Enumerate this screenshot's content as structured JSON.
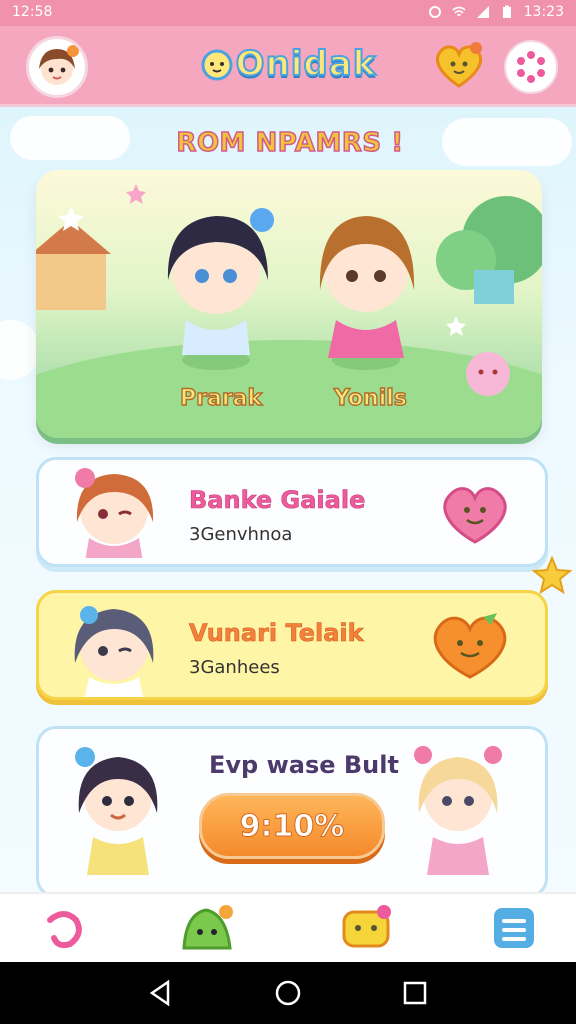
{
  "status_bar": {
    "left_text": "12:58",
    "time": "13:23"
  },
  "header": {
    "logo_text": "Onidak",
    "icons": {
      "profile": "avatar-girl-icon",
      "favorites": "heart-icon",
      "settings": "gear-icon"
    }
  },
  "banner": {
    "title": "ROM NPAMRS !",
    "characters": [
      {
        "name": "Prarak"
      },
      {
        "name": "Yonils"
      }
    ]
  },
  "cards": [
    {
      "title": "Banke Gaiale",
      "subtitle": "3Genvhnoa",
      "icon": "pink-heart-creature-icon",
      "accent": "#ee5b9c"
    },
    {
      "title": "Vunari Telaik",
      "subtitle": "3Ganhees",
      "icon": "orange-heart-creature-icon",
      "accent": "#f3803b"
    }
  ],
  "progress_card": {
    "title": "Evp wase Bult",
    "value_label": "9:10%",
    "accent": "#f48a2c"
  },
  "bottom_nav": [
    {
      "icon": "swirl-icon",
      "color": "#ee5b9c"
    },
    {
      "icon": "green-slime-icon",
      "color": "#7ac94d"
    },
    {
      "icon": "yellow-chat-icon",
      "color": "#f6d53b"
    },
    {
      "icon": "menu-icon",
      "color": "#55aee3"
    }
  ],
  "system_nav": {
    "icons": [
      "back-icon",
      "home-icon",
      "recents-icon"
    ]
  }
}
